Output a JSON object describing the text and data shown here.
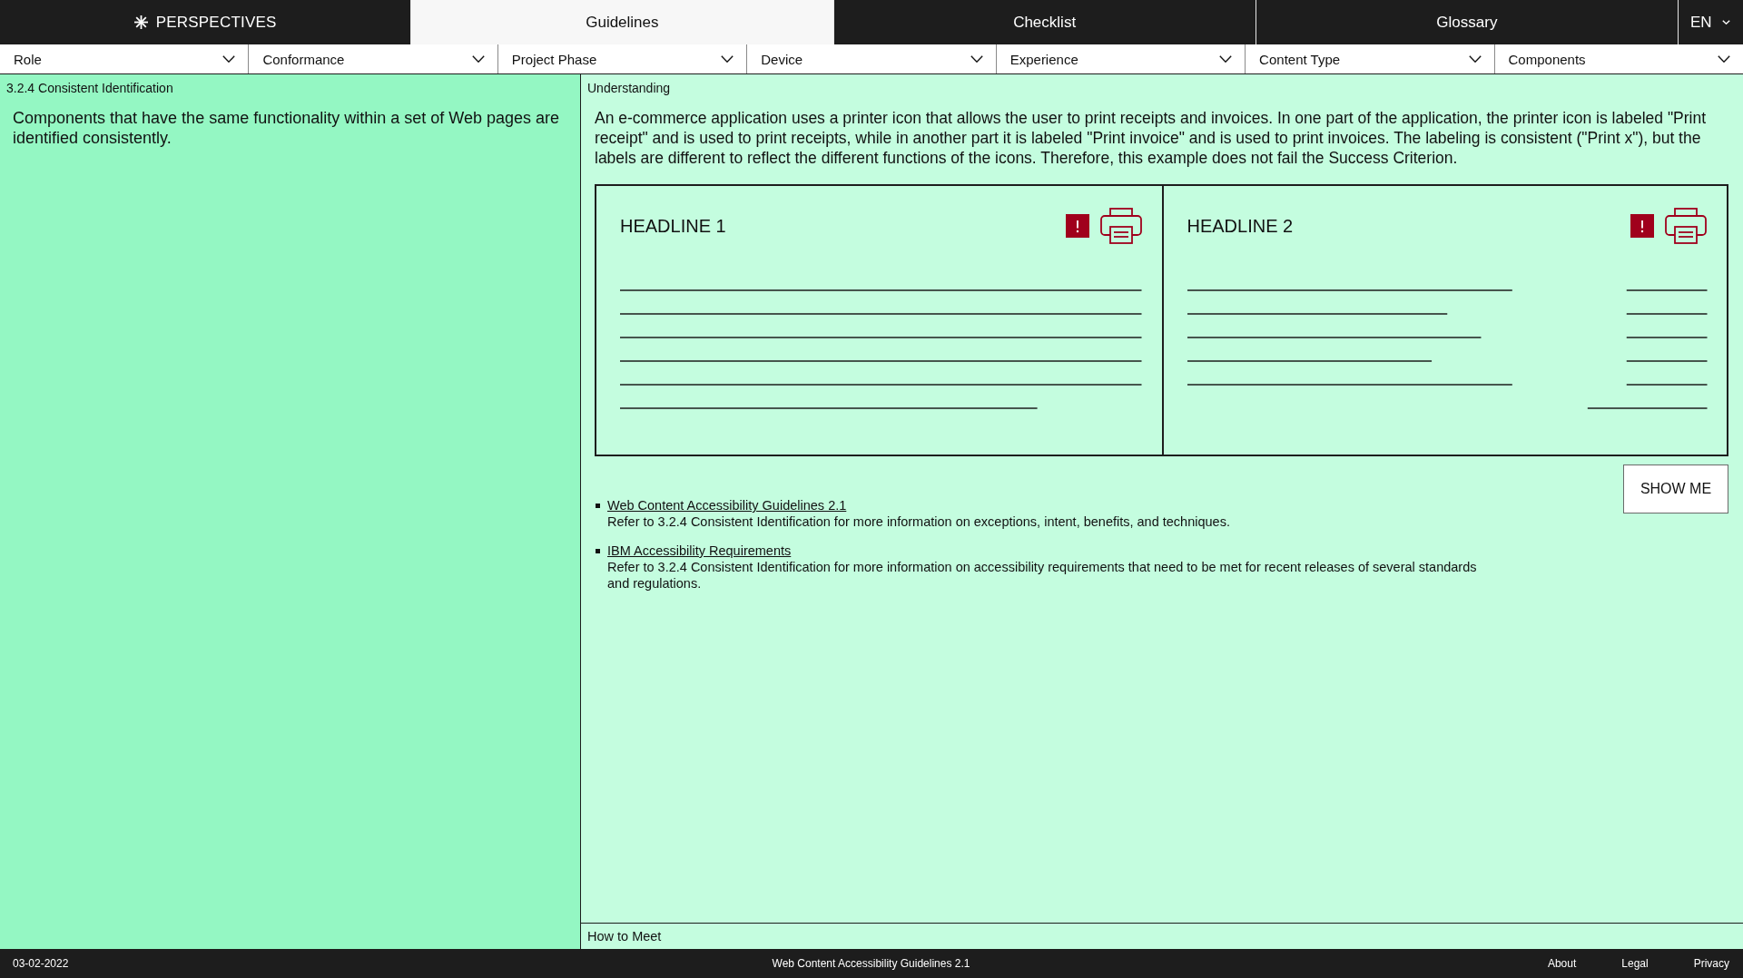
{
  "nav": {
    "brand": "PERSPECTIVES",
    "tabs": [
      {
        "label": "Guidelines",
        "selected": true
      },
      {
        "label": "Checklist",
        "selected": false
      },
      {
        "label": "Glossary",
        "selected": false
      }
    ],
    "language": "EN"
  },
  "filters": [
    "Role",
    "Conformance",
    "Project Phase",
    "Device",
    "Experience",
    "Content Type",
    "Components"
  ],
  "requirement": {
    "title": "3.2.4 Consistent Identification",
    "text": "Components that have the same functionality within a set of Web pages are identified consistently."
  },
  "understanding": {
    "title": "Understanding",
    "text": "An e-commerce application uses a printer icon that allows the user to print receipts and invoices. In one part of the application, the printer icon is labeled \"Print receipt\" and is used to print receipts, while in another part it is labeled \"Print invoice\" and is used to print invoices. The labeling is consistent (\"Print x\"), but the labels are different to reflect the different functions of the icons. Therefore, this example does not fail the Success Criterion.",
    "example_cards": [
      {
        "kind": "single-column",
        "headline": "HEADLINE 1"
      },
      {
        "kind": "two-column",
        "headline": "HEADLINE 2"
      }
    ],
    "button": "SHOW ME",
    "resources": [
      {
        "link": "Web Content Accessibility Guidelines 2.1",
        "description": "Refer to 3.2.4 Consistent Identification for more information on exceptions, intent, benefits, and techniques."
      },
      {
        "link": "IBM Accessibility Requirements",
        "description": "Refer to 3.2.4 Consistent Identification for more information on accessibility requirements that need to be met for recent releases of several standards and regulations."
      }
    ]
  },
  "how_to_meet": {
    "title": "How to Meet"
  },
  "footer": {
    "date": "03-02-2022",
    "center": "Web Content Accessibility Guidelines 2.1",
    "links": [
      "About",
      "Legal",
      "Privacy"
    ]
  }
}
